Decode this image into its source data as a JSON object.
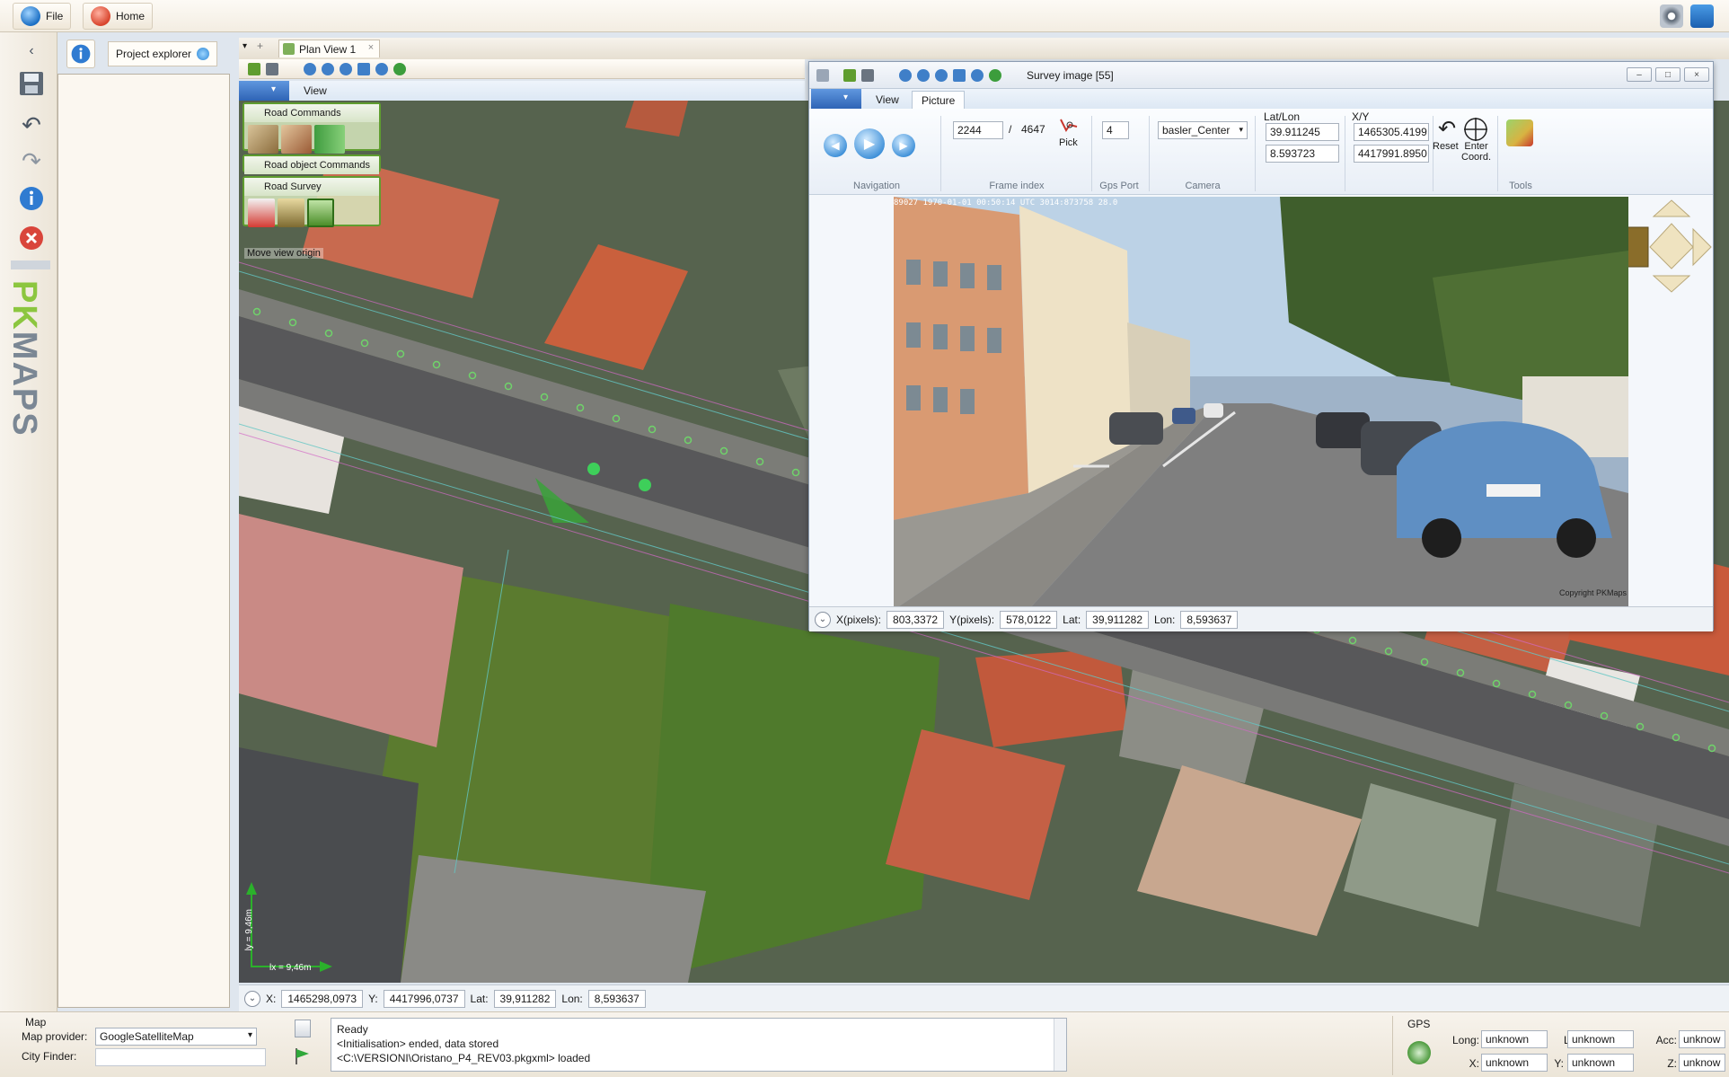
{
  "topbar": {
    "file_label": "File",
    "home_label": "Home"
  },
  "brand": {
    "pk": "PK",
    "maps": "MAPS"
  },
  "explorer": {
    "tab_label": "Project explorer"
  },
  "plan_view": {
    "tab_label": "Plan View 1",
    "ribbon_tab": "View",
    "road_commands_label": "Road Commands",
    "road_object_commands_label": "Road object Commands",
    "road_survey_label": "Road Survey",
    "tooltip": "Move view origin",
    "scale_h": "lx = 9,46m",
    "scale_v": "ly = 9,46m",
    "coords": {
      "x_label": "X:",
      "x_value": "1465298,0973",
      "y_label": "Y:",
      "y_value": "4417996,0737",
      "lat_label": "Lat:",
      "lat_value": "39,911282",
      "lon_label": "Lon:",
      "lon_value": "8,593637"
    }
  },
  "survey": {
    "title": "Survey image [55]",
    "tabs": [
      "View",
      "Picture"
    ],
    "navigation_label": "Navigation",
    "frame_index": {
      "current": "2244",
      "separator": "/",
      "total": "4647",
      "label": "Frame index",
      "pick_label": "Pick"
    },
    "gps_port": {
      "value": "4",
      "label": "Gps Port"
    },
    "camera": {
      "value": "basler_Center",
      "label": "Camera"
    },
    "latlon": {
      "label": "Lat/Lon",
      "lat": "39.911245",
      "lon": "8.593723"
    },
    "xy": {
      "label": "X/Y",
      "x": "1465305.4199",
      "y": "4417991.8950"
    },
    "reset_label": "Reset",
    "enter_coord_label": "Enter\nCoord.",
    "tools_label": "Tools",
    "photo_overlay": "89027 1970-01-01 00:50:14 UTC     3014:873758  28.0",
    "copyright": "Copyright PKMaps",
    "status": {
      "xpix_label": "X(pixels):",
      "xpix_value": "803,3372",
      "ypix_label": "Y(pixels):",
      "ypix_value": "578,0122",
      "lat_label": "Lat:",
      "lat_value": "39,911282",
      "lon_label": "Lon:",
      "lon_value": "8,593637"
    }
  },
  "bottom": {
    "map_title": "Map",
    "provider_label": "Map provider:",
    "provider_value": "GoogleSatelliteMap",
    "city_label": "City Finder:",
    "log_lines": [
      "Ready",
      "<Initialisation> ended, data stored",
      "<C:\\VERSIONI\\Oristano_P4_REV03.pkgxml> loaded"
    ]
  },
  "gps": {
    "title": "GPS",
    "long_label": "Long:",
    "long_value": "unknown",
    "lat_label": "Lat:",
    "lat_value": "unknown",
    "acc_label": "Acc:",
    "acc_value": "unknow",
    "x_label": "X:",
    "x_value": "unknown",
    "y_label": "Y:",
    "y_value": "unknown",
    "z_label": "Z:",
    "z_value": "unknow"
  },
  "colors": {
    "brand_green": "#8cc63f",
    "brand_grey": "#7b8794",
    "ribbon_blue": "#2f64b5",
    "panel_green": "#5f9d2f"
  }
}
